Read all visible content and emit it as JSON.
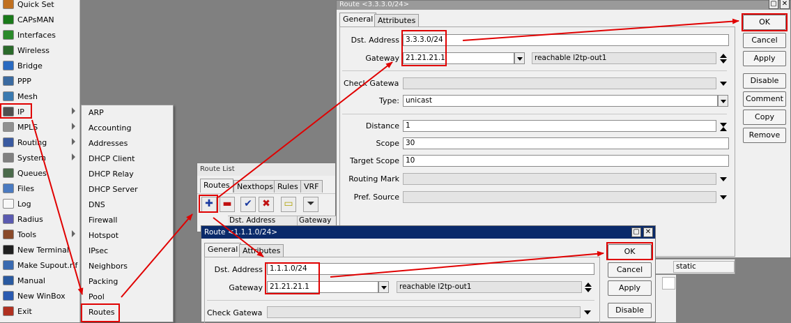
{
  "sidebar": {
    "items": [
      {
        "label": "Quick Set",
        "icon": "quick-set-icon",
        "color": "#c07020",
        "submenu": false
      },
      {
        "label": "CAPsMAN",
        "icon": "capsman-icon",
        "color": "#1a7a1a",
        "submenu": false
      },
      {
        "label": "Interfaces",
        "icon": "interfaces-icon",
        "color": "#2a8a2a",
        "submenu": false
      },
      {
        "label": "Wireless",
        "icon": "wireless-icon",
        "color": "#2a6a2a",
        "submenu": false
      },
      {
        "label": "Bridge",
        "icon": "bridge-icon",
        "color": "#2a6ac0",
        "submenu": false
      },
      {
        "label": "PPP",
        "icon": "ppp-icon",
        "color": "#3a6aa0",
        "submenu": false
      },
      {
        "label": "Mesh",
        "icon": "mesh-icon",
        "color": "#3a7ab0",
        "submenu": false
      },
      {
        "label": "IP",
        "icon": "ip-icon",
        "color": "#505050",
        "submenu": true
      },
      {
        "label": "MPLS",
        "icon": "mpls-icon",
        "color": "#909090",
        "submenu": true
      },
      {
        "label": "Routing",
        "icon": "routing-icon",
        "color": "#3a5aa0",
        "submenu": true
      },
      {
        "label": "System",
        "icon": "system-icon",
        "color": "#808080",
        "submenu": true
      },
      {
        "label": "Queues",
        "icon": "queues-icon",
        "color": "#4a6a4a",
        "submenu": false
      },
      {
        "label": "Files",
        "icon": "files-icon",
        "color": "#4a7ac0",
        "submenu": false
      },
      {
        "label": "Log",
        "icon": "log-icon",
        "color": "#f8f8f8",
        "submenu": false
      },
      {
        "label": "Radius",
        "icon": "radius-icon",
        "color": "#5a5ab0",
        "submenu": false
      },
      {
        "label": "Tools",
        "icon": "tools-icon",
        "color": "#8a4a2a",
        "submenu": true
      },
      {
        "label": "New Terminal",
        "icon": "terminal-icon",
        "color": "#202020",
        "submenu": false
      },
      {
        "label": "Make Supout.rif",
        "icon": "supout-icon",
        "color": "#3a6ab0",
        "submenu": false
      },
      {
        "label": "Manual",
        "icon": "manual-icon",
        "color": "#2a5aa0",
        "submenu": false
      },
      {
        "label": "New WinBox",
        "icon": "winbox-icon",
        "color": "#2a5ab0",
        "submenu": false
      },
      {
        "label": "Exit",
        "icon": "exit-icon",
        "color": "#b03020",
        "submenu": false
      }
    ]
  },
  "ip_submenu": {
    "items": [
      "ARP",
      "Accounting",
      "Addresses",
      "DHCP Client",
      "DHCP Relay",
      "DHCP Server",
      "DNS",
      "Firewall",
      "Hotspot",
      "IPsec",
      "Neighbors",
      "Packing",
      "Pool",
      "Routes"
    ]
  },
  "route_list": {
    "title": "Route List",
    "tabs": [
      "Routes",
      "Nexthops",
      "Rules",
      "VRF"
    ],
    "columns": [
      "Dst. Address",
      "Gateway"
    ],
    "status_value": "static"
  },
  "route_3": {
    "title": "Route <3.3.3.0/24>",
    "tabs": [
      "General",
      "Attributes"
    ],
    "labels": {
      "dst": "Dst. Address",
      "gateway": "Gateway",
      "check_gateway": "Check Gateway",
      "type": "Type:",
      "distance": "Distance",
      "scope": "Scope",
      "target_scope": "Target Scope",
      "routing_mark": "Routing Mark",
      "pref_source": "Pref. Source"
    },
    "values": {
      "dst": "3.3.3.0/24",
      "gateway": "21.21.21.1",
      "gateway_status": "reachable l2tp-out1",
      "type": "unicast",
      "distance": "1",
      "scope": "30",
      "target_scope": "10"
    },
    "buttons": [
      "OK",
      "Cancel",
      "Apply",
      "Disable",
      "Comment",
      "Copy",
      "Remove"
    ]
  },
  "route_1": {
    "title": "Route <1.1.1.0/24>",
    "tabs": [
      "General",
      "Attributes"
    ],
    "labels": {
      "dst": "Dst. Address",
      "gateway": "Gateway",
      "check_gateway": "Check Gateway"
    },
    "values": {
      "dst": "1.1.1.0/24",
      "gateway": "21.21.21.1",
      "gateway_status": "reachable l2tp-out1"
    },
    "buttons": [
      "OK",
      "Cancel",
      "Apply",
      "Disable"
    ]
  },
  "colors": {
    "highlight": "#e00000",
    "active_title": "#0a2a6a",
    "inactive_title": "#7e7e7e",
    "desktop": "#808080"
  }
}
